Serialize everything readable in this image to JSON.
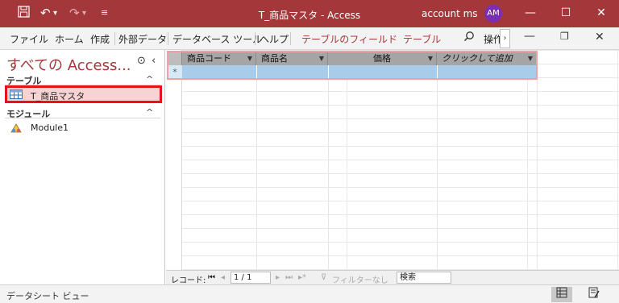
{
  "titlebar": {
    "title": "T_商品マスタ  -  Access",
    "account": "account ms",
    "avatar": "AM",
    "icons": [
      "save-icon",
      "undo-icon",
      "redo-icon",
      "customize-qat-icon"
    ],
    "window_controls": [
      "minimize",
      "maximize",
      "close"
    ]
  },
  "ribbon": {
    "tabs": [
      "ファイル",
      "ホーム",
      "作成",
      "外部データ",
      "データベース ツール",
      "ヘルプ"
    ],
    "context_tabs": [
      "テーブルのフィールド",
      "テーブル"
    ],
    "tell_me": "操作",
    "overflow": "›",
    "window_controls": [
      "ribbon-minimize",
      "ribbon-restore",
      "ribbon-close"
    ]
  },
  "nav": {
    "header": "すべての Access...",
    "groups": [
      {
        "label": "テーブル",
        "items": [
          "T_商品マスタ"
        ]
      },
      {
        "label": "モジュール",
        "items": [
          "Module1"
        ]
      }
    ]
  },
  "datasheet": {
    "columns": [
      "商品コード",
      "商品名",
      "価格",
      "クリックして追加"
    ],
    "new_row_marker": "*"
  },
  "record_nav": {
    "label": "レコード:",
    "position": "1 / 1",
    "filter": "フィルターなし",
    "search": "検索"
  },
  "status": {
    "text": "データシート ビュー"
  },
  "colors": {
    "accent": "#a4373a",
    "highlight_border": "#e8121d",
    "new_row": "#a8cdea"
  }
}
